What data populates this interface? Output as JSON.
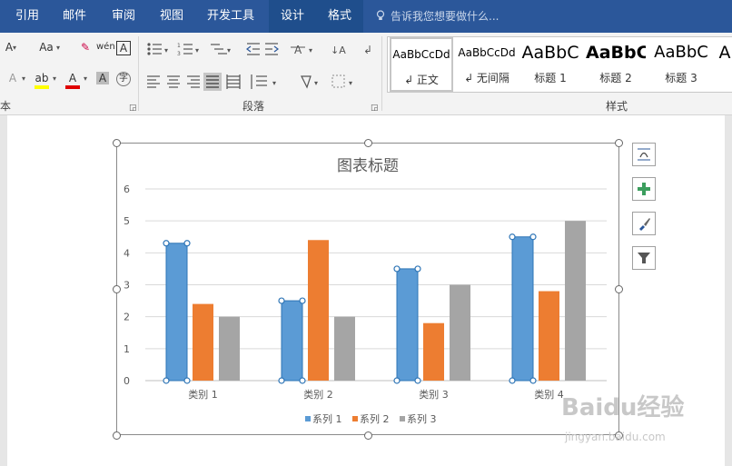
{
  "menubar": {
    "tabs": [
      {
        "label": "引用"
      },
      {
        "label": "邮件"
      },
      {
        "label": "审阅"
      },
      {
        "label": "视图"
      },
      {
        "label": "开发工具"
      },
      {
        "label": "设计"
      },
      {
        "label": "格式"
      }
    ],
    "tellme": "告诉我您想要做什么..."
  },
  "ribbon": {
    "paragraph_label": "段落",
    "styles_label": "样式",
    "font_label_partial": "本",
    "aa_label": "Aa",
    "wen_label": "wén",
    "styles": [
      {
        "sample": "AaBbCcDd",
        "name": "↲ 正文"
      },
      {
        "sample": "AaBbCcDd",
        "name": "↲ 无间隔"
      },
      {
        "sample": "AaBbC",
        "name": "标题 1"
      },
      {
        "sample": "AaBbC",
        "name": "标题 2"
      },
      {
        "sample": "AaBbC",
        "name": "标题 3"
      },
      {
        "sample": "A",
        "name": ""
      }
    ]
  },
  "chart_data": {
    "type": "bar",
    "title": "图表标题",
    "categories": [
      "类别 1",
      "类别 2",
      "类别 3",
      "类别 4"
    ],
    "series": [
      {
        "name": "系列 1",
        "values": [
          4.3,
          2.5,
          3.5,
          4.5
        ],
        "color": "#5b9bd5"
      },
      {
        "name": "系列 2",
        "values": [
          2.4,
          4.4,
          1.8,
          2.8
        ],
        "color": "#ed7d31"
      },
      {
        "name": "系列 3",
        "values": [
          2,
          2,
          3,
          5
        ],
        "color": "#a5a5a5"
      }
    ],
    "yticks": [
      "0",
      "1",
      "2",
      "3",
      "4",
      "5",
      "6"
    ],
    "ylim": [
      0,
      6
    ],
    "grid": true,
    "legend": "bottom"
  },
  "watermark": {
    "main": "Baidu经验",
    "url": "jingyan.baidu.com"
  }
}
